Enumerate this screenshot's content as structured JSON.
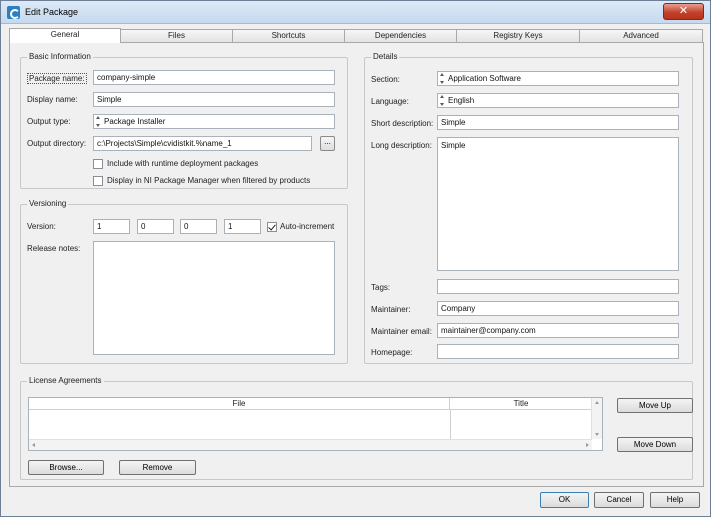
{
  "window": {
    "title": "Edit Package",
    "close_label": "✕"
  },
  "tabs": [
    {
      "label": "General",
      "active": true
    },
    {
      "label": "Files"
    },
    {
      "label": "Shortcuts"
    },
    {
      "label": "Dependencies"
    },
    {
      "label": "Registry Keys"
    },
    {
      "label": "Advanced"
    }
  ],
  "basic_info": {
    "legend": "Basic Information",
    "package_name_label": "Package name:",
    "package_name_value": "company-simple",
    "display_name_label": "Display name:",
    "display_name_value": "Simple",
    "output_type_label": "Output type:",
    "output_type_value": "Package Installer",
    "output_dir_label": "Output directory:",
    "output_dir_value": "c:\\Projects\\Simple\\cvidistkit.%name_1",
    "browse_ellipsis": "...",
    "include_runtime_label": "Include with runtime deployment packages",
    "include_runtime_checked": false,
    "display_nipm_label": "Display in NI Package Manager when filtered by products",
    "display_nipm_checked": false
  },
  "versioning": {
    "legend": "Versioning",
    "version_label": "Version:",
    "v1": "1",
    "v2": "0",
    "v3": "0",
    "v4": "1",
    "auto_increment_label": "Auto-increment",
    "auto_increment_checked": true,
    "release_notes_label": "Release notes:",
    "release_notes_value": ""
  },
  "details": {
    "legend": "Details",
    "section_label": "Section:",
    "section_value": "Application Software",
    "language_label": "Language:",
    "language_value": "English",
    "short_desc_label": "Short description:",
    "short_desc_value": "Simple",
    "long_desc_label": "Long description:",
    "long_desc_value": "Simple",
    "tags_label": "Tags:",
    "tags_value": "",
    "maintainer_label": "Maintainer:",
    "maintainer_value": "Company",
    "maintainer_email_label": "Maintainer email:",
    "maintainer_email_value": "maintainer@company.com",
    "homepage_label": "Homepage:",
    "homepage_value": ""
  },
  "license": {
    "legend": "License Agreements",
    "columns": [
      "File",
      "Title"
    ],
    "move_up_label": "Move Up",
    "move_down_label": "Move Down",
    "browse_label": "Browse...",
    "remove_label": "Remove"
  },
  "footer": {
    "ok_label": "OK",
    "cancel_label": "Cancel",
    "help_label": "Help"
  }
}
